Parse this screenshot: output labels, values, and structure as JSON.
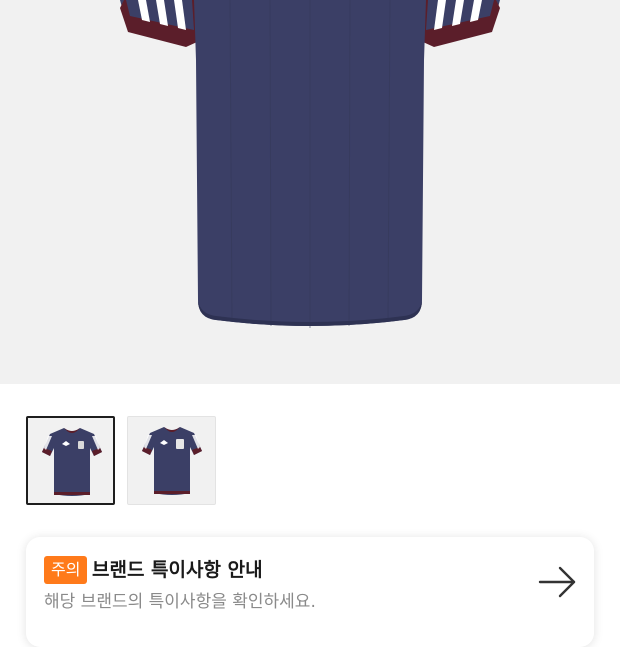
{
  "product": {
    "main_image": "navy-jersey-back-view",
    "colors": {
      "body": "#3b3f66",
      "trim": "#5b1e2a",
      "stripe": "#ffffff",
      "background": "#f1f1f1"
    },
    "thumbnails": [
      {
        "name": "navy-jersey-front",
        "selected": true
      },
      {
        "name": "navy-jersey-front-alt",
        "selected": false
      }
    ]
  },
  "notice": {
    "badge": "주의",
    "title": "브랜드 특이사항 안내",
    "description": "해당 브랜드의 특이사항을 확인하세요.",
    "arrow_icon": "arrow-right-icon",
    "badge_color": "#ff7a1a"
  }
}
